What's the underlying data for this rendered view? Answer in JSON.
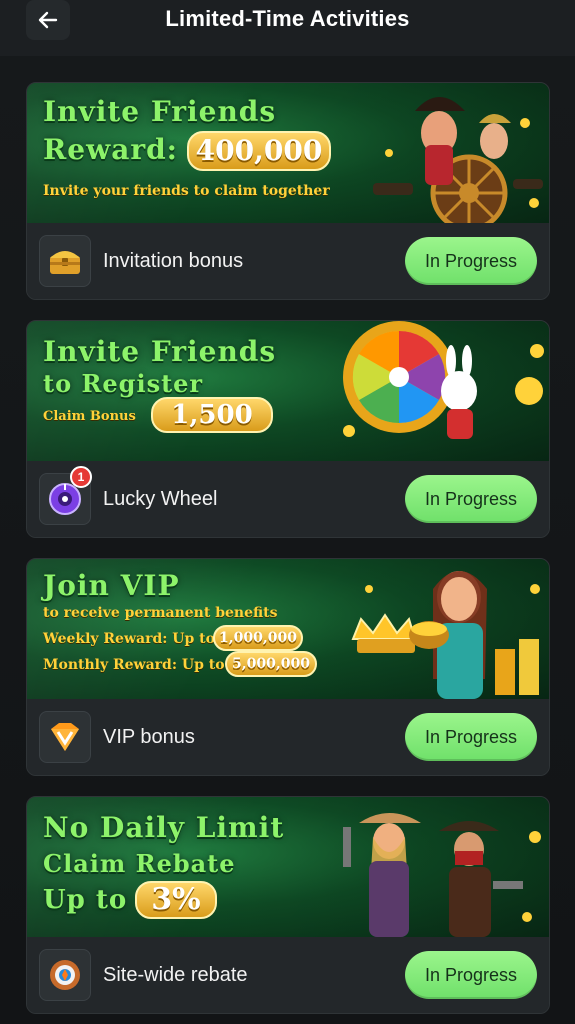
{
  "header": {
    "title": "Limited-Time Activities",
    "back_icon": "back-arrow-icon"
  },
  "status_button_color": "#7ee97a",
  "cards": [
    {
      "banner_lines": [
        "Invite Friends",
        "Reward:"
      ],
      "highlight": "400,000",
      "subline": "Invite your friends to claim together",
      "label": "Invitation bonus",
      "icon": "treasure-chest-icon",
      "status": "In Progress"
    },
    {
      "banner_lines": [
        "Invite Friends",
        "to Register"
      ],
      "sub_prefix": "Claim Bonus",
      "highlight": "1,500",
      "label": "Lucky Wheel",
      "icon": "lucky-wheel-icon",
      "badge": "1",
      "status": "In Progress"
    },
    {
      "banner_lines": [
        "Join VIP"
      ],
      "subline": "to receive permanent benefits",
      "weekly_label": "Weekly Reward: Up to",
      "weekly_value": "1,000,000",
      "monthly_label": "Monthly Reward: Up to",
      "monthly_value": "5,000,000",
      "label": "VIP bonus",
      "icon": "vip-gem-icon",
      "status": "In Progress"
    },
    {
      "banner_lines": [
        "No Daily Limit",
        "Claim Rebate",
        "Up to"
      ],
      "highlight": "3%",
      "label": "Site-wide rebate",
      "icon": "rebate-coin-icon",
      "status": "In Progress"
    }
  ]
}
